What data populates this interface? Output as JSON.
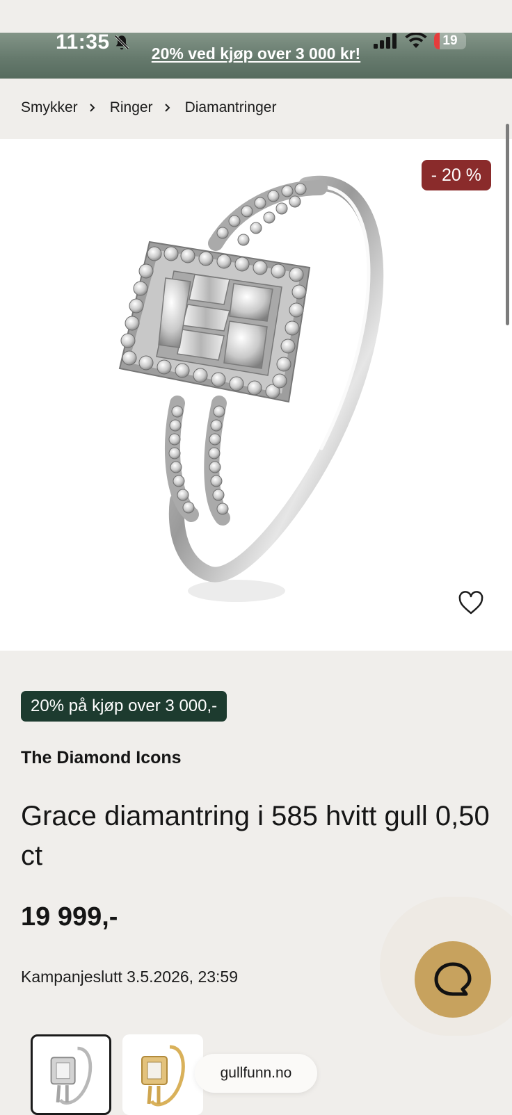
{
  "status_bar": {
    "time": "11:35",
    "battery_level": "19",
    "icons": [
      "bell-slash-icon",
      "signal-icon",
      "wifi-icon",
      "battery-icon"
    ]
  },
  "promo_bar": {
    "text": "20% ved kjøp over 3 000 kr!",
    "color": "#667a6d"
  },
  "breadcrumb": {
    "items": [
      "Smykker",
      "Ringer",
      "Diamantringer"
    ]
  },
  "product": {
    "discount_badge": "- 20 %",
    "promo_pill": "20% på kjøp over 3 000,-",
    "brand": "The Diamond Icons",
    "title": "Grace diamantring i 585 hvitt gull 0,50 ct",
    "price": "19 999,-",
    "campaign": "Kampanjeslutt 3.5.2026, 23:59"
  },
  "variants": [
    {
      "name": "white-gold",
      "selected": true
    },
    {
      "name": "yellow-gold",
      "selected": false
    }
  ],
  "domain": "gullfunn.no",
  "colors": {
    "discount": "#8a2b2b",
    "promo_pill": "#1d3b2f",
    "chat_button": "#c7a25e",
    "page_background": "#f0eeeb"
  }
}
